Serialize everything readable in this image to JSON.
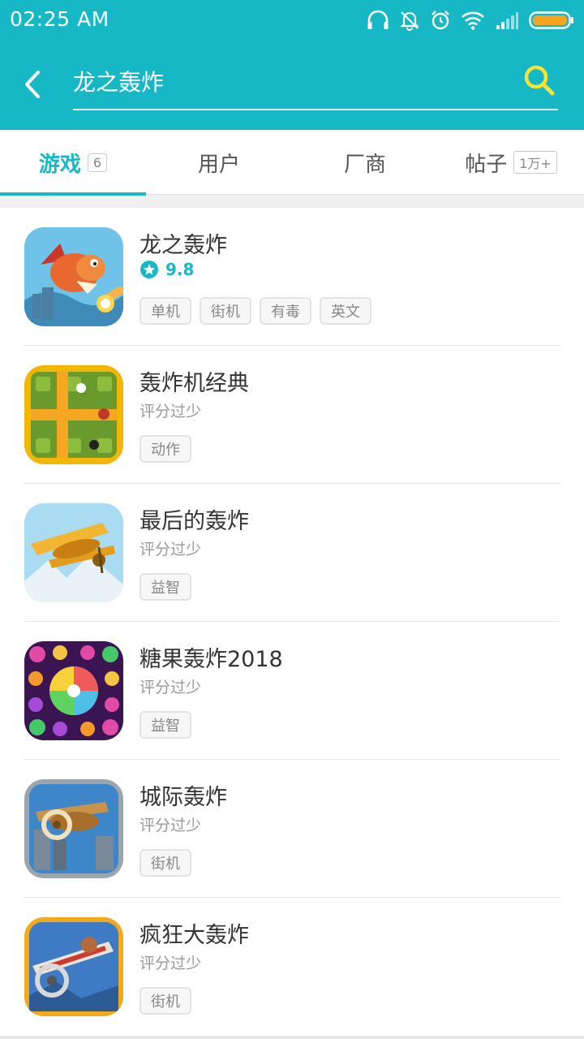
{
  "status_bar": {
    "time": "02:25  AM",
    "icons": [
      "headphones-icon",
      "bell-off-icon",
      "alarm-icon",
      "wifi-icon",
      "signal-icon",
      "battery-icon"
    ]
  },
  "search": {
    "value": "龙之轰炸"
  },
  "tabs": [
    {
      "label": "游戏",
      "count": "6",
      "active": true
    },
    {
      "label": "用户",
      "count": "",
      "active": false
    },
    {
      "label": "厂商",
      "count": "",
      "active": false
    },
    {
      "label": "帖子",
      "count": "1万+",
      "active": false
    }
  ],
  "results": [
    {
      "name": "龙之轰炸",
      "rating": "9.8",
      "tags": [
        "单机",
        "街机",
        "有毒",
        "英文"
      ]
    },
    {
      "name": "轰炸机经典",
      "rating_text": "评分过少",
      "tags": [
        "动作"
      ]
    },
    {
      "name": "最后的轰炸",
      "rating_text": "评分过少",
      "tags": [
        "益智"
      ]
    },
    {
      "name": "糖果轰炸2018",
      "rating_text": "评分过少",
      "tags": [
        "益智"
      ]
    },
    {
      "name": "城际轰炸",
      "rating_text": "评分过少",
      "tags": [
        "街机"
      ]
    },
    {
      "name": "疯狂大轰炸",
      "rating_text": "评分过少",
      "tags": [
        "街机"
      ]
    }
  ],
  "colors": {
    "accent": "#17b8c6",
    "search_icon": "#f7e338"
  }
}
